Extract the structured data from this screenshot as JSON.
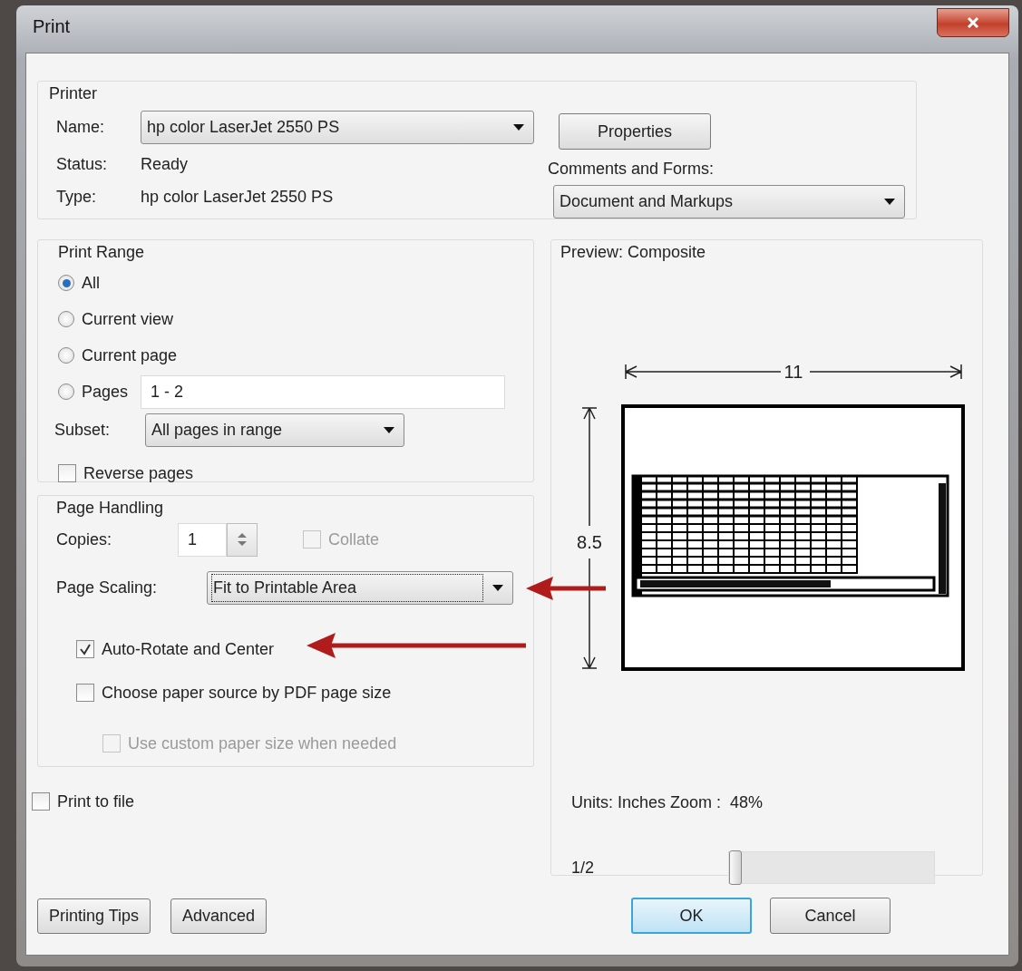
{
  "window": {
    "title": "Print"
  },
  "printer": {
    "group_label": "Printer",
    "name_label": "Name:",
    "name_value": "hp color LaserJet 2550 PS",
    "status_label": "Status:",
    "status_value": "Ready",
    "type_label": "Type:",
    "type_value": "hp color LaserJet 2550 PS",
    "properties_button": "Properties",
    "comments_label": "Comments and Forms:",
    "comments_value": "Document and Markups"
  },
  "print_range": {
    "group_label": "Print Range",
    "options": [
      {
        "label": "All",
        "selected": true
      },
      {
        "label": "Current view",
        "selected": false
      },
      {
        "label": "Current page",
        "selected": false
      },
      {
        "label": "Pages",
        "selected": false
      }
    ],
    "pages_value": "1 - 2",
    "subset_label": "Subset:",
    "subset_value": "All pages in range",
    "reverse": {
      "label": "Reverse pages",
      "checked": false
    }
  },
  "page_handling": {
    "group_label": "Page Handling",
    "copies_label": "Copies:",
    "copies_value": "1",
    "collate": {
      "label": "Collate",
      "checked": false,
      "disabled": true
    },
    "scaling_label": "Page Scaling:",
    "scaling_value": "Fit to Printable Area",
    "scaling_focused": true,
    "checkboxes": [
      {
        "label": "Auto-Rotate and Center",
        "checked": true,
        "disabled": false
      },
      {
        "label": "Choose paper source by PDF page size",
        "checked": false,
        "disabled": false,
        "children": [
          {
            "label": "Use custom paper size when needed",
            "checked": false,
            "disabled": true
          }
        ]
      }
    ]
  },
  "print_to_file": {
    "label": "Print to file",
    "checked": false
  },
  "preview": {
    "group_label": "Preview: Composite",
    "width_label": "11",
    "height_label": "8.5",
    "units_zoom": "Units: Inches Zoom :  48%",
    "page_label": "1/2",
    "page_slider": {
      "level": 0
    }
  },
  "left_buttons": [
    {
      "label": "Printing Tips"
    },
    {
      "label": "Advanced"
    }
  ],
  "right_buttons": [
    {
      "label": "OK",
      "default": true
    },
    {
      "label": "Cancel",
      "default": false
    }
  ]
}
